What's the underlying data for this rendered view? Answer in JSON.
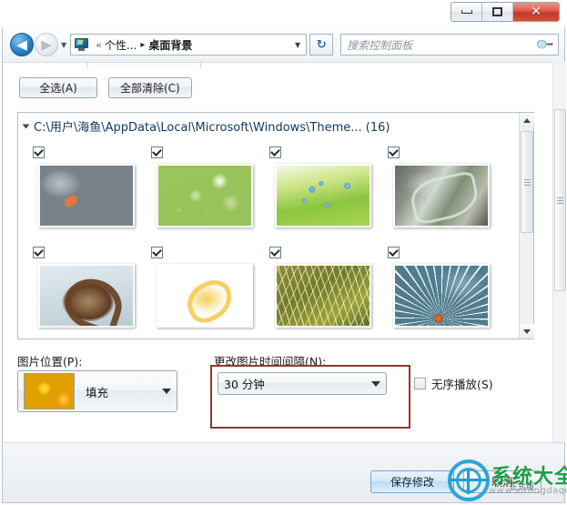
{
  "window": {
    "caption_buttons": {
      "minimize": "minimize-icon",
      "maximize": "maximize-icon",
      "close": "✕"
    }
  },
  "navbar": {
    "back_glyph": "◀",
    "forward_glyph": "▶",
    "history_caret": "▼",
    "address_icon": "display-icon",
    "breadcrumb_chevron": "«",
    "breadcrumb_first": "个性...",
    "breadcrumb_separator": "▸",
    "breadcrumb_current": "桌面背景",
    "address_dropdown_caret": "▼",
    "refresh_glyph": "↻",
    "search_placeholder": "搜索控制面板",
    "search_value": "",
    "search_icon": "🔍"
  },
  "toolbar": {
    "select_all_label": "全选(A)",
    "clear_all_label": "全部清除(C)"
  },
  "picture_list": {
    "group_path": "C:\\用户\\海鱼\\AppData\\Local\\Microsoft\\Windows\\Theme... (16)",
    "group_count": 16,
    "thumbnails": [
      {
        "name": "river-stones",
        "checked": true,
        "style": "tb-stones"
      },
      {
        "name": "water-drops-leaf",
        "checked": true,
        "style": "tb-drops"
      },
      {
        "name": "forget-me-nots",
        "checked": true,
        "style": "tb-forget"
      },
      {
        "name": "frosted-leaves",
        "checked": true,
        "style": "tb-frost"
      },
      {
        "name": "snail-shell",
        "checked": true,
        "style": "tb-shell"
      },
      {
        "name": "white-rose",
        "checked": true,
        "style": "tb-rose"
      },
      {
        "name": "golden-grass",
        "checked": true,
        "style": "tb-grass"
      },
      {
        "name": "dandelion-seed",
        "checked": true,
        "style": "tb-dande"
      }
    ],
    "scrollbar": {
      "up_arrow": "▲",
      "down_arrow": "▼"
    }
  },
  "controls": {
    "position_label": "图片位置(P):",
    "position_value": "填充",
    "position_caret": "▼",
    "interval_label": "更改图片时间间隔(N):",
    "interval_value": "30 分钟",
    "interval_caret": "▼",
    "shuffle_label": "无序播放(S)",
    "shuffle_checked": false,
    "highlight_color": "#a03030"
  },
  "footer": {
    "save_label": "保存修改",
    "cancel_label": "取消"
  },
  "watermark": {
    "brand_text": "系统大全",
    "url_text": "www.xitongdaquan.com",
    "sub_text": "正式版",
    "top_text": ""
  }
}
